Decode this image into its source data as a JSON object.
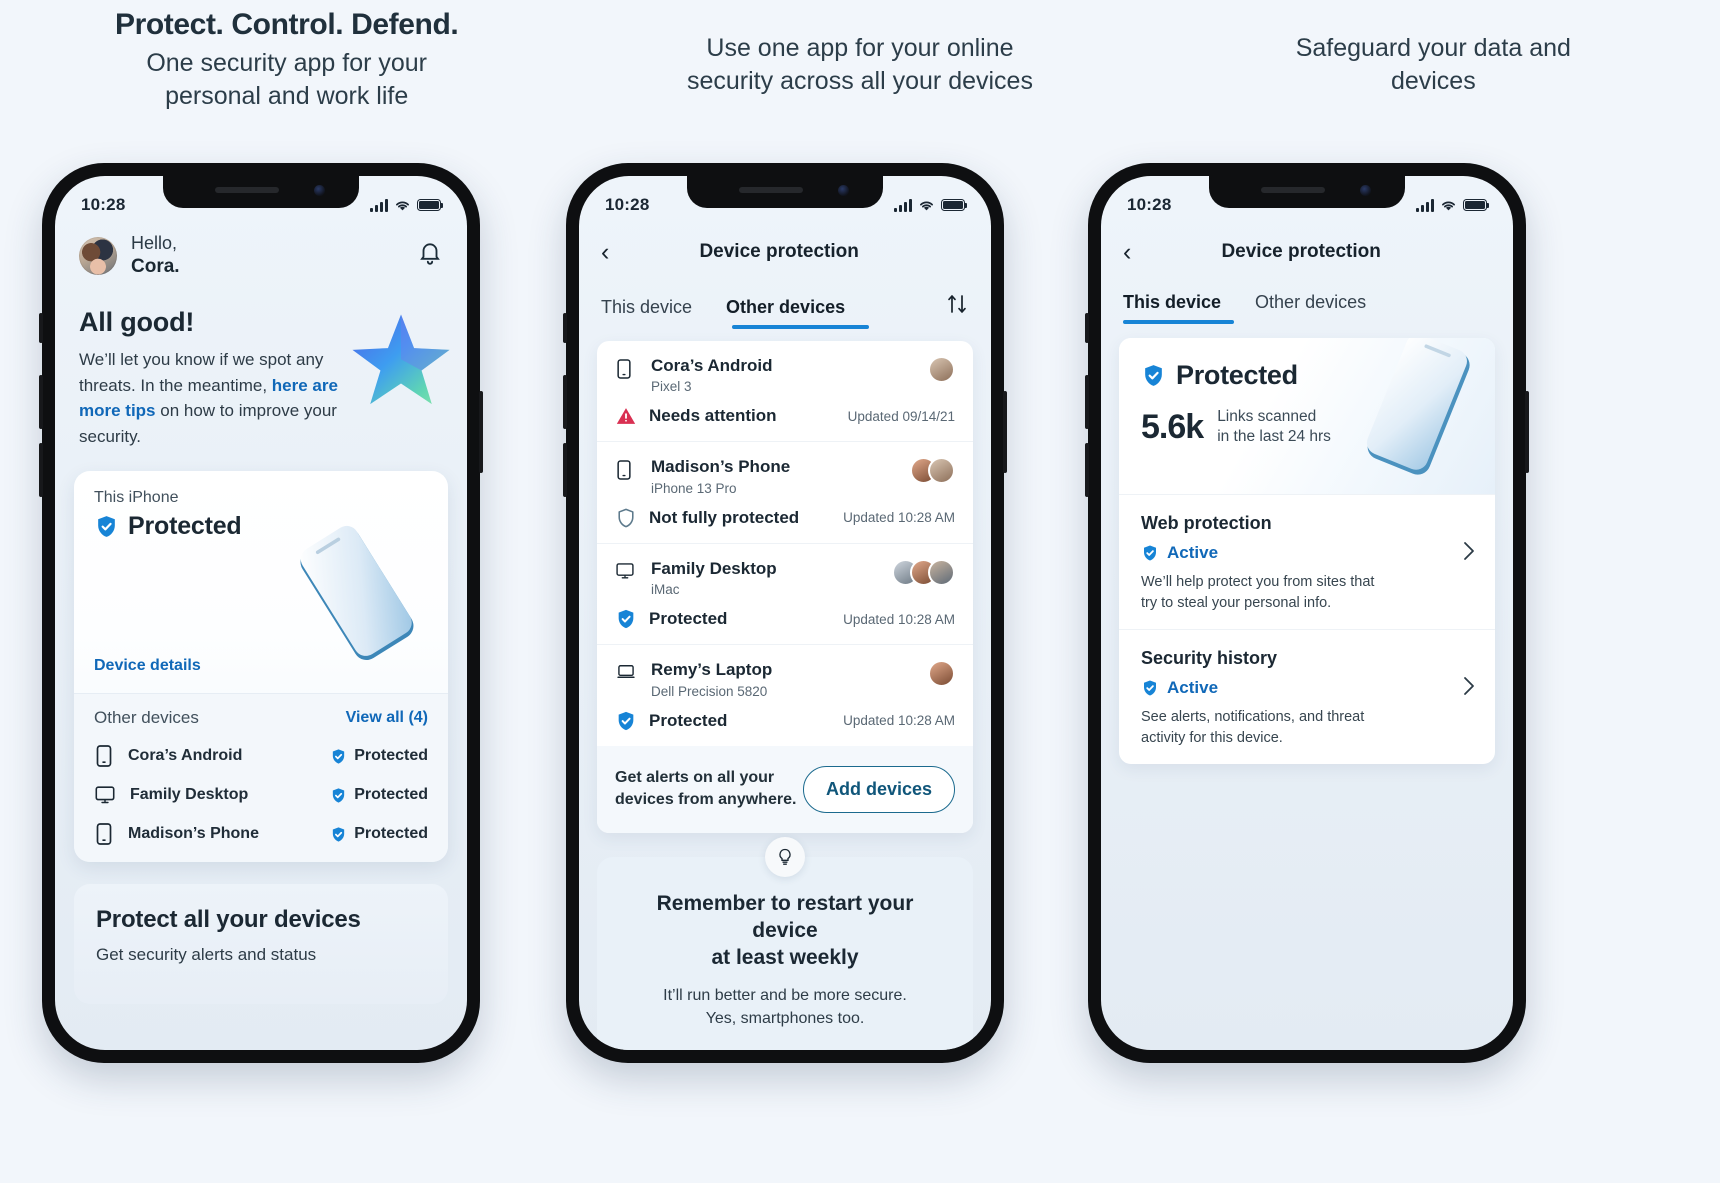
{
  "headlines": [
    {
      "title": "Protect. Control. Defend.",
      "subtitle": "One security app for your\npersonal and work life"
    },
    {
      "title": "",
      "subtitle": "Use one app for your online\nsecurity across all your devices"
    },
    {
      "title": "",
      "subtitle": "Safeguard your data and\ndevices"
    }
  ],
  "status_bar": {
    "time": "10:28",
    "signal_icon": "signal-bars-icon",
    "wifi_icon": "wifi-icon",
    "battery_icon": "battery-icon"
  },
  "screen1": {
    "greeting_line1": "Hello,",
    "greeting_line2": "Cora.",
    "avatar_name": "avatar",
    "bell_icon": "notification-bell-icon",
    "heading": "All good!",
    "blurb_part1": "We’ll let you know if we spot any threats. In the meantime, ",
    "blurb_link": "here are more tips",
    "blurb_part2": " on how to improve your security.",
    "card": {
      "label": "This iPhone",
      "status": "Protected",
      "details_link": "Device details"
    },
    "other_devices": {
      "label": "Other devices",
      "view_all": "View all (4)",
      "items": [
        {
          "name": "Cora’s Android",
          "icon": "phone-icon",
          "status": "Protected"
        },
        {
          "name": "Family Desktop",
          "icon": "desktop-icon",
          "status": "Protected"
        },
        {
          "name": "Madison’s Phone",
          "icon": "phone-icon",
          "status": "Protected"
        }
      ]
    },
    "promo": {
      "title": "Protect all your devices",
      "text": "Get security alerts and status"
    }
  },
  "screen2": {
    "nav_title": "Device protection",
    "back_icon": "back-chevron-icon",
    "sort_icon": "sort-arrows-icon",
    "tabs": [
      {
        "label": "This device",
        "active": false
      },
      {
        "label": "Other devices",
        "active": true
      }
    ],
    "devices": [
      {
        "name": "Cora’s Android",
        "model": "Pixel 3",
        "device_icon": "phone-icon",
        "status": "Needs attention",
        "status_icon": "warning-triangle-icon",
        "status_color": "#d93052",
        "updated": "Updated 09/14/21",
        "faces": 1
      },
      {
        "name": "Madison’s Phone",
        "model": "iPhone 13 Pro",
        "device_icon": "phone-icon",
        "status": "Not fully protected",
        "status_icon": "shield-outline-icon",
        "status_color": "#5d7a8c",
        "updated": "Updated 10:28 AM",
        "faces": 2
      },
      {
        "name": "Family Desktop",
        "model": "iMac",
        "device_icon": "desktop-icon",
        "status": "Protected",
        "status_icon": "shield-check-icon",
        "status_color": "#1784d6",
        "updated": "Updated 10:28 AM",
        "faces": 3
      },
      {
        "name": "Remy’s Laptop",
        "model": "Dell Precision 5820",
        "device_icon": "laptop-icon",
        "status": "Protected",
        "status_icon": "shield-check-icon",
        "status_color": "#1784d6",
        "updated": "Updated 10:28 AM",
        "faces": 1
      }
    ],
    "add_bar": {
      "text": "Get alerts on all your devices from anywhere.",
      "button": "Add devices"
    },
    "tip": {
      "icon": "lightbulb-icon",
      "title": "Remember to restart your device at least weekly",
      "text": "It’ll run better and be more secure.\nYes, smartphones too."
    }
  },
  "screen3": {
    "nav_title": "Device protection",
    "back_icon": "back-chevron-icon",
    "tabs": [
      {
        "label": "This device",
        "active": true
      },
      {
        "label": "Other devices",
        "active": false
      }
    ],
    "hero": {
      "status": "Protected",
      "status_icon": "shield-check-icon",
      "metric_value": "5.6k",
      "metric_label": "Links scanned\nin the last 24 hrs"
    },
    "sections": [
      {
        "title": "Web protection",
        "state": "Active",
        "state_icon": "shield-check-icon",
        "description": "We’ll help protect you from sites that try to steal your personal info.",
        "chevron": "chevron-right-icon"
      },
      {
        "title": "Security history",
        "state": "Active",
        "state_icon": "shield-check-icon",
        "description": "See alerts, notifications, and threat activity for this device.",
        "chevron": "chevron-right-icon"
      }
    ]
  },
  "colors": {
    "accent_blue": "#1784d6",
    "link_blue": "#1068b8",
    "danger_red": "#d93052",
    "page_bg": "#f2f6fb"
  }
}
